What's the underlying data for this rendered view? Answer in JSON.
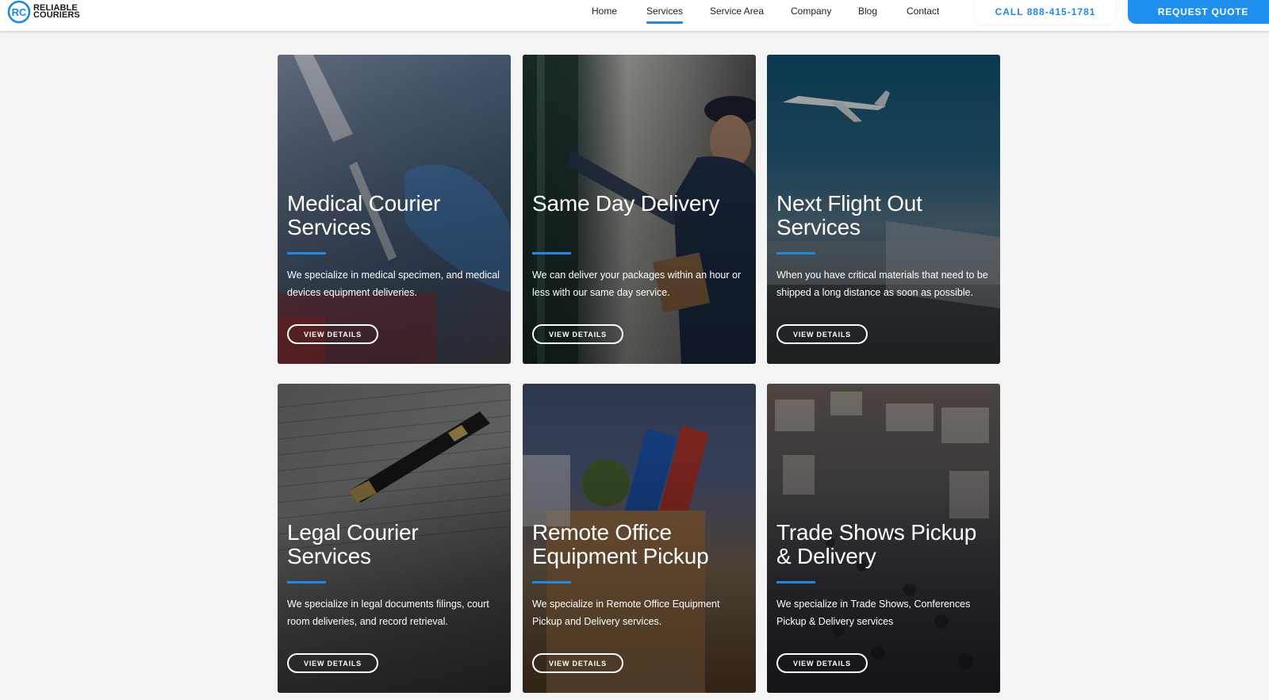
{
  "brand": {
    "line1": "RELIABLE",
    "line2": "COURIERS",
    "accent": "#1e88e5"
  },
  "nav": {
    "items": [
      {
        "label": "Home"
      },
      {
        "label": "Services",
        "active": true
      },
      {
        "label": "Service Area"
      },
      {
        "label": "Company"
      },
      {
        "label": "Blog"
      },
      {
        "label": "Contact"
      }
    ],
    "call_label": "CALL 888-415-1781",
    "quote_label": "REQUEST QUOTE"
  },
  "cards": [
    {
      "title": "Medical Courier Services",
      "description": "We specialize in medical specimen, and medical devices equipment deliveries.",
      "button": "VIEW DETAILS"
    },
    {
      "title": "Same Day Delivery",
      "description": "We can deliver your packages within an hour or less with our same day service.",
      "button": "VIEW DETAILS"
    },
    {
      "title": "Next Flight Out Services",
      "description": "When you have critical materials that need to be shipped a long distance as soon as possible.",
      "button": "VIEW DETAILS"
    },
    {
      "title": "Legal Courier Services",
      "description": "We specialize in legal documents filings, court room deliveries, and record retrieval.",
      "button": "VIEW DETAILS"
    },
    {
      "title": "Remote Office Equipment Pickup",
      "description": "We specialize in Remote Office Equipment Pickup and Delivery services.",
      "button": "VIEW DETAILS"
    },
    {
      "title": "Trade Shows Pickup & Delivery",
      "description": "We specialize in Trade Shows, Conferences Pickup & Delivery services",
      "button": "VIEW DETAILS"
    }
  ],
  "colors": {
    "accent": "#1e88e5",
    "quote_button": "#1e8fef",
    "page_bg": "#f4f4f4"
  }
}
